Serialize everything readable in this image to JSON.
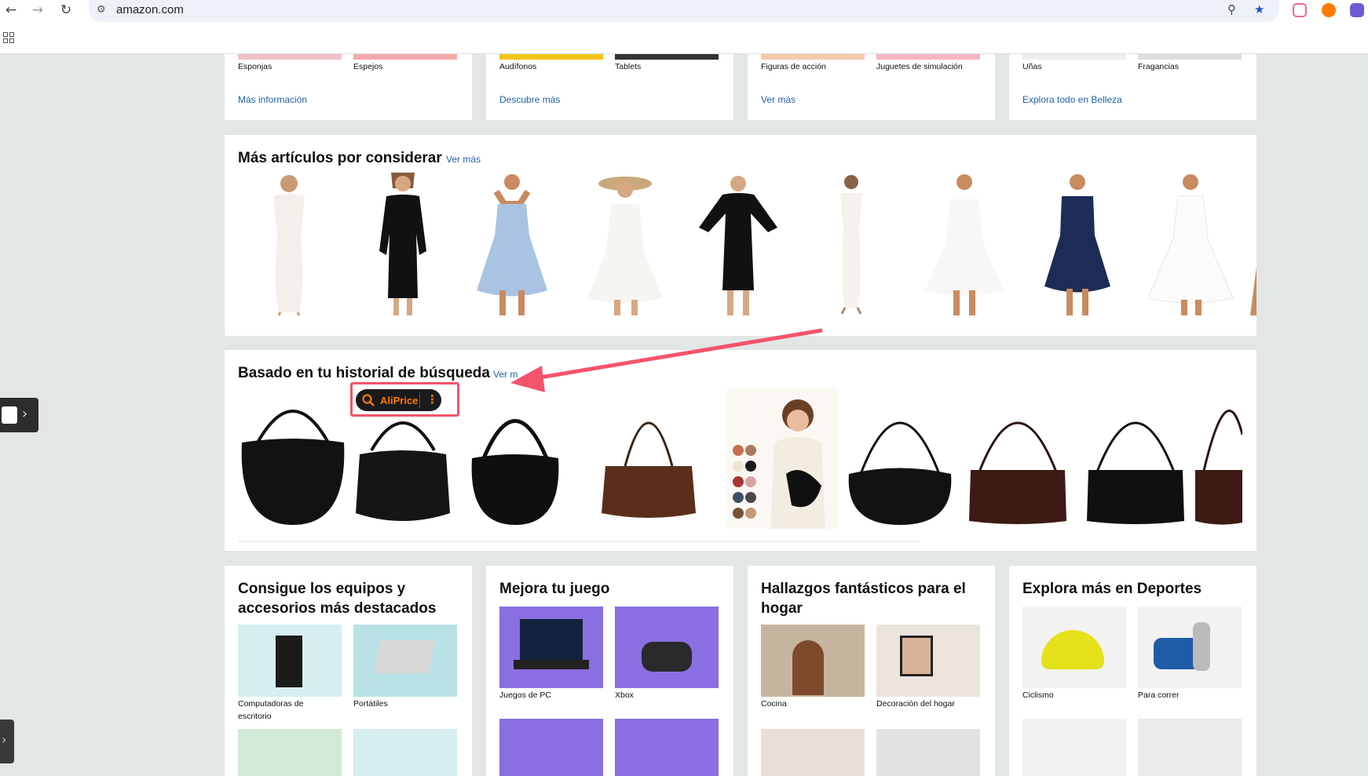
{
  "browser": {
    "url": "amazon.com",
    "back_icon": "arrow-left-icon",
    "forward_icon": "arrow-right-icon",
    "reload_icon": "reload-icon"
  },
  "top_cards": [
    {
      "items": [
        "Esponjas",
        "Espejos"
      ],
      "link": "Más información"
    },
    {
      "items": [
        "Audífonos",
        "Tablets"
      ],
      "link": "Descubre más"
    },
    {
      "items": [
        "Figuras de acción",
        "Juguetes de simulación"
      ],
      "link": "Ver más"
    },
    {
      "items": [
        "Uñas",
        "Fragancias"
      ],
      "link": "Explora todo en Belleza"
    }
  ],
  "more_items": {
    "title": "Más artículos por considerar",
    "link": "Ver más"
  },
  "search_history": {
    "title": "Basado en tu historial de búsqueda",
    "link": "Ver m"
  },
  "aliprice": {
    "label": "AliPrice"
  },
  "bottom_cards": [
    {
      "title": "Consigue los equipos y accesorios más destacados",
      "items": [
        "Computadoras de escritorio",
        "Portátiles"
      ]
    },
    {
      "title": "Mejora tu juego",
      "items": [
        "Juegos de PC",
        "Xbox"
      ]
    },
    {
      "title": "Hallazgos fantásticos para el hogar",
      "items": [
        "Cocina",
        "Decoración del hogar"
      ]
    },
    {
      "title": "Explora más en Deportes",
      "items": [
        "Ciclismo",
        "Para correr"
      ]
    }
  ],
  "colors": {
    "link": "#2162a1",
    "page_bg": "#e3e6e6",
    "annotation": "#f3546b",
    "aliprice_orange": "#ff7a00"
  }
}
